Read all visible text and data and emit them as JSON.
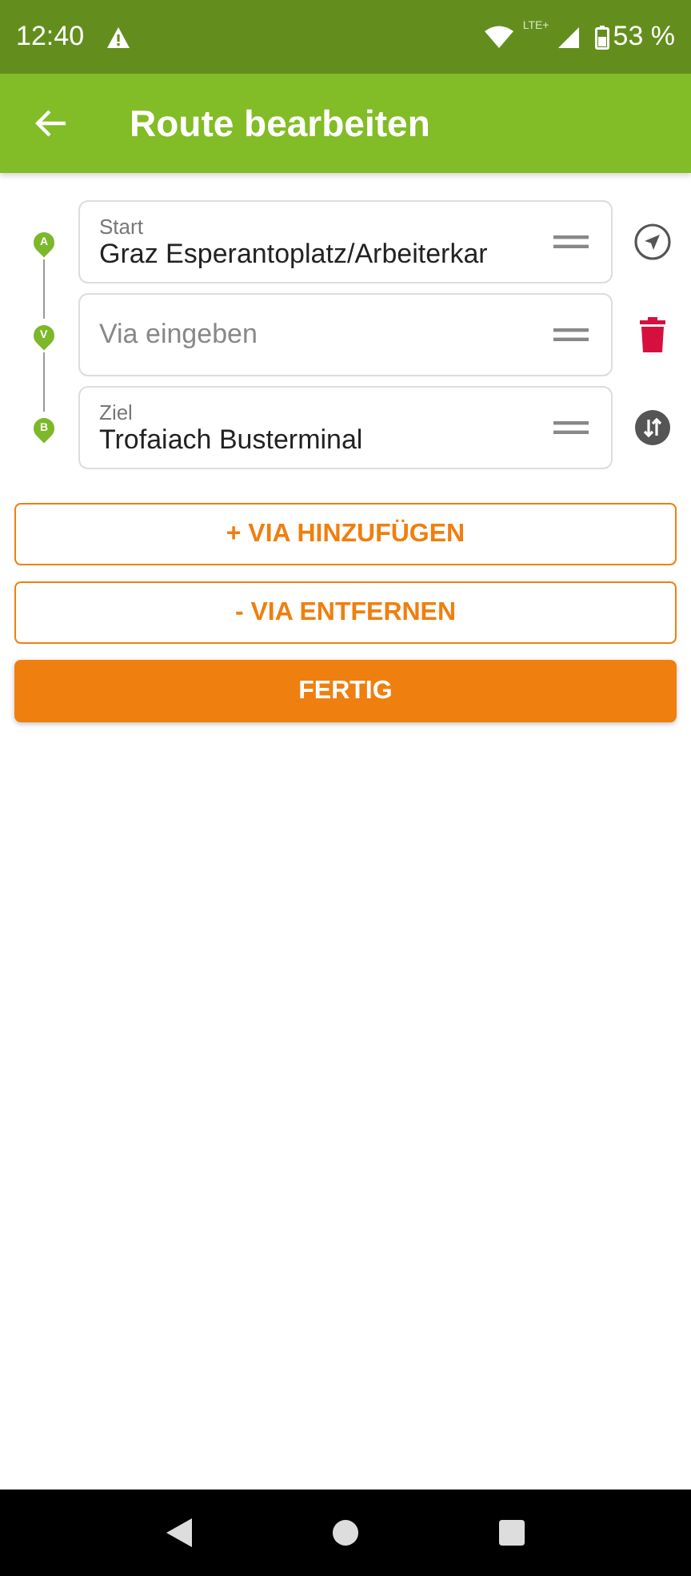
{
  "status_bar": {
    "time": "12:40",
    "network": "LTE+",
    "battery": "53 %"
  },
  "app_bar": {
    "title": "Route bearbeiten"
  },
  "stops": [
    {
      "marker": "A",
      "label": "Start",
      "value": "Graz Esperantoplatz/Arbeiterkar",
      "kind": "locate"
    },
    {
      "marker": "V",
      "placeholder": "Via eingeben",
      "kind": "delete"
    },
    {
      "marker": "B",
      "label": "Ziel",
      "value": "Trofaiach Busterminal",
      "kind": "swap"
    }
  ],
  "buttons": [
    {
      "label": "+ VIA HINZUFÜGEN",
      "kind": "outline"
    },
    {
      "label": "- VIA ENTFERNEN",
      "kind": "outline"
    },
    {
      "label": "FERTIG",
      "kind": "filled"
    }
  ]
}
